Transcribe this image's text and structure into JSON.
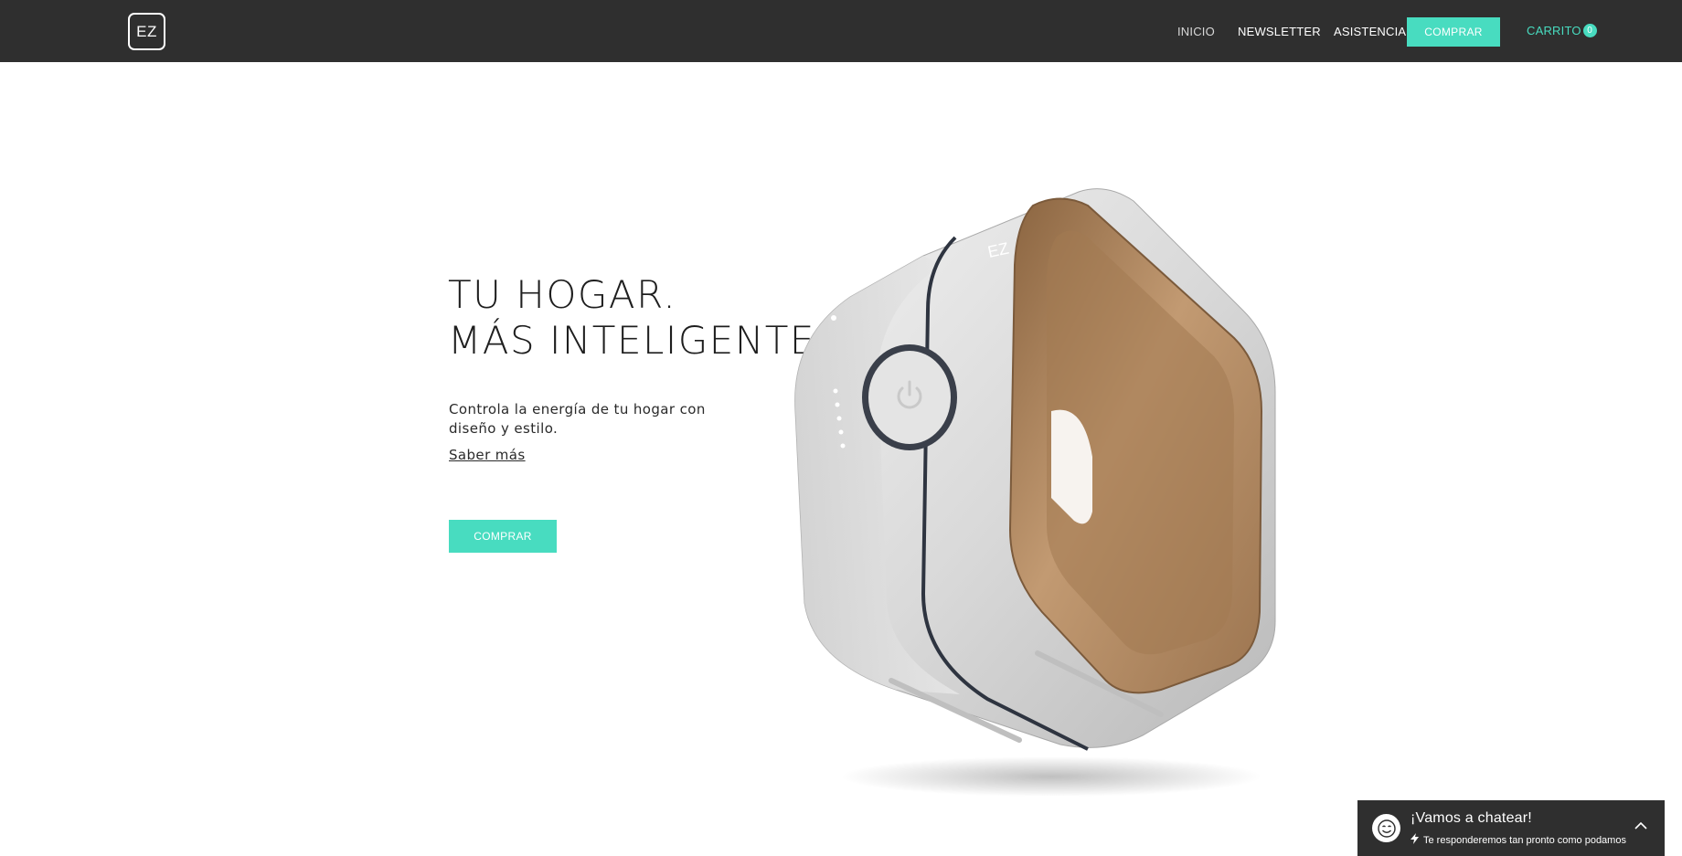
{
  "header": {
    "logo_text": "EZ",
    "nav": {
      "home": "INICIO",
      "newsletter": "NEWSLETTER",
      "support": "ASISTENCIA",
      "buy": "COMPRAR",
      "cart": "CARRITO",
      "cart_count": "0"
    }
  },
  "hero": {
    "title_line1": "TU HOGAR.",
    "title_line2": "MÁS INTELIGENTE.",
    "subtitle": "Controla la energía de tu hogar con diseño y estilo.",
    "more_link": "Saber más",
    "buy_button": "COMPRAR",
    "product_brand": "EZ"
  },
  "chat": {
    "title": "¡Vamos a chatear!",
    "note": "Te responderemos tan pronto como podamos",
    "icons": {
      "avatar": "smiley-face-icon",
      "note": "lightning-bolt-icon",
      "toggle": "chevron-up-icon"
    }
  },
  "colors": {
    "header_bg": "#2f2f2f",
    "accent": "#48dcc0",
    "text_dark": "#1e1e1e"
  }
}
